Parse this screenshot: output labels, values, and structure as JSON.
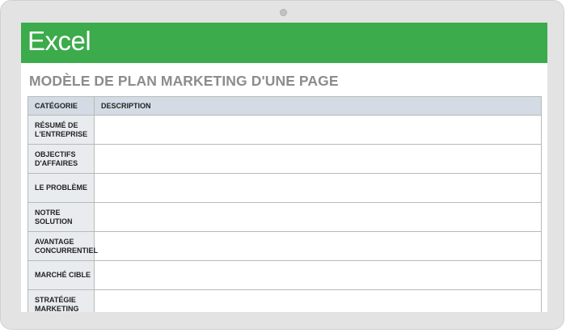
{
  "app": {
    "name": "Excel"
  },
  "sheet": {
    "title": "MODÈLE DE PLAN MARKETING D'UNE PAGE",
    "columns": [
      "CATÉGORIE",
      "DESCRIPTION"
    ],
    "rows": [
      {
        "category": "RÉSUMÉ DE L'ENTREPRISE",
        "description": ""
      },
      {
        "category": "OBJECTIFS D'AFFAIRES",
        "description": ""
      },
      {
        "category": "LE PROBLÈME",
        "description": ""
      },
      {
        "category": "NOTRE SOLUTION",
        "description": ""
      },
      {
        "category": "AVANTAGE CONCURRENTIEL",
        "description": ""
      },
      {
        "category": "MARCHÉ CIBLE",
        "description": ""
      },
      {
        "category": "STRATÉGIE MARKETING",
        "description": ""
      }
    ]
  },
  "colors": {
    "banner": "#3cab4b",
    "header_row": "#d3dbe4",
    "category_cell": "#e9ecef"
  }
}
